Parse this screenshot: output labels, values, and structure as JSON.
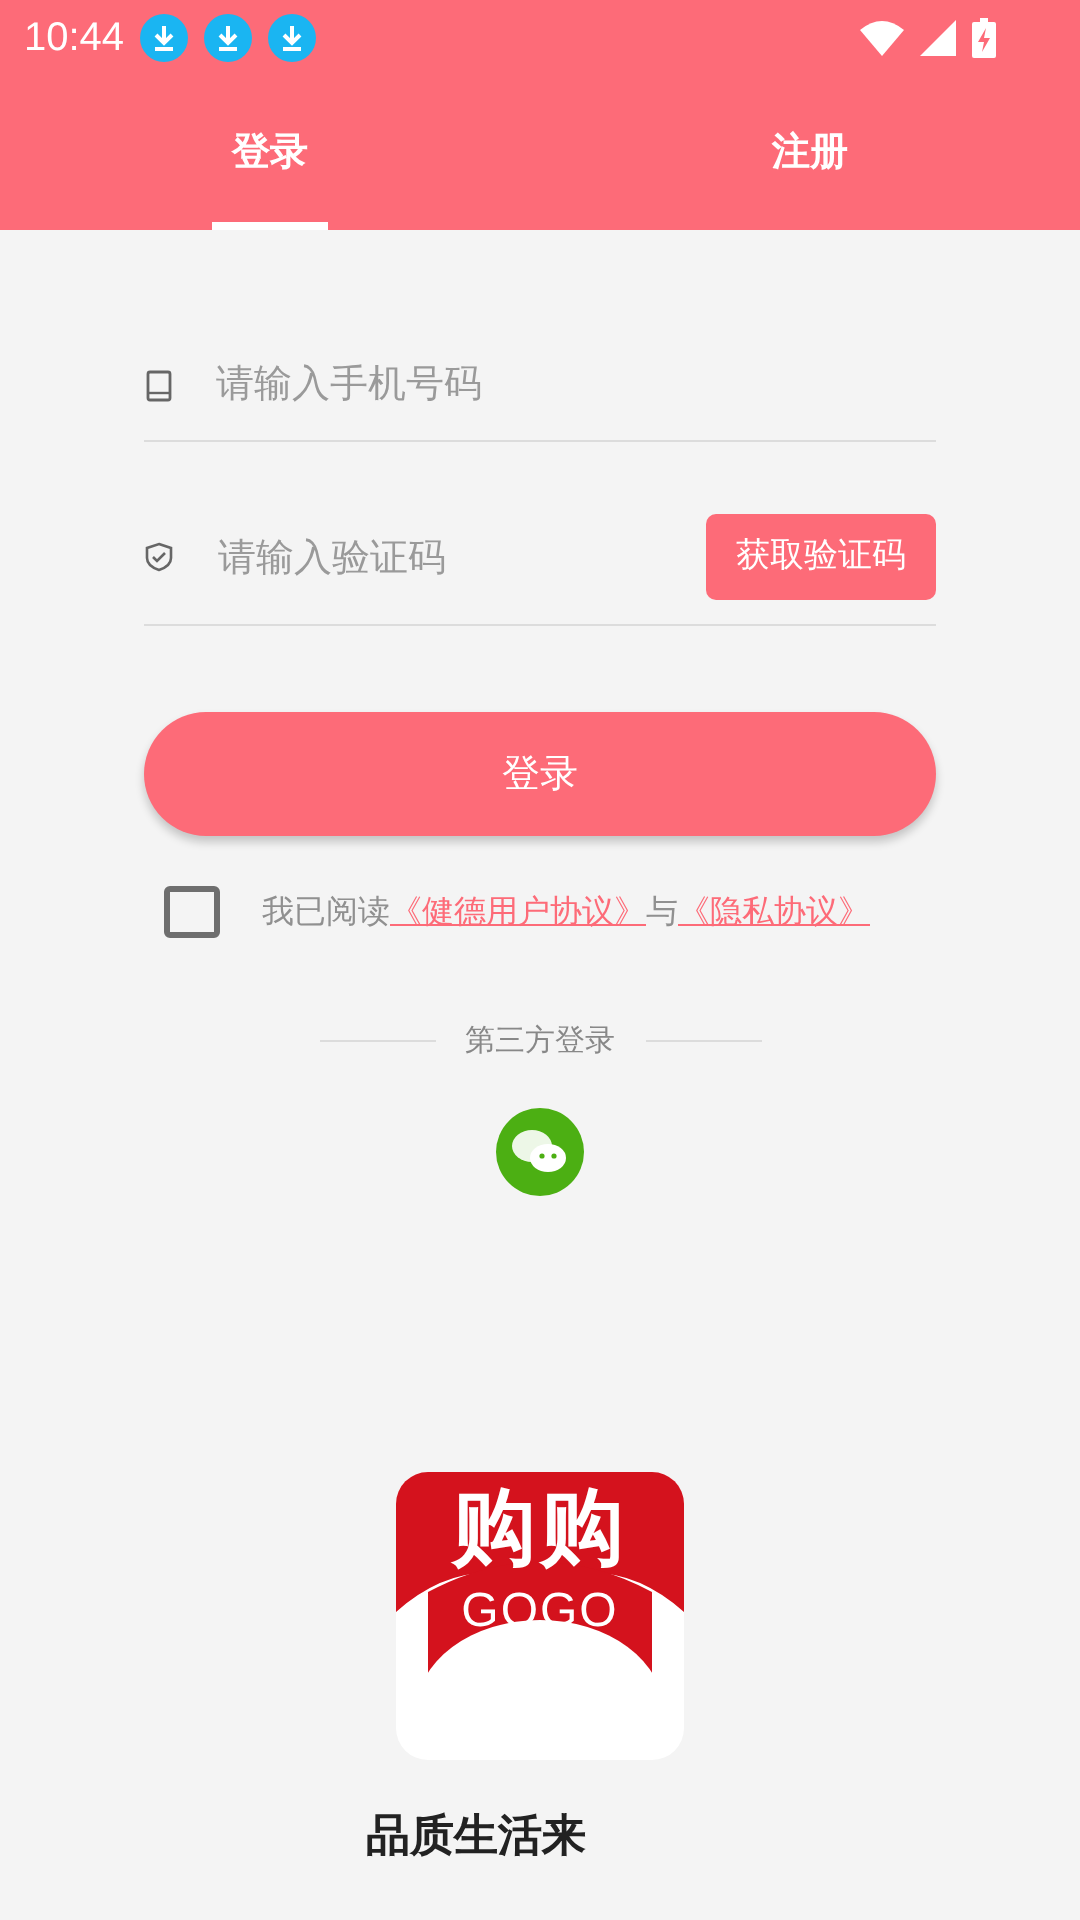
{
  "status_bar": {
    "time": "10:44",
    "notifications": [
      {
        "kind": "download"
      },
      {
        "kind": "download"
      },
      {
        "kind": "download"
      }
    ]
  },
  "tabs": [
    {
      "label": "登录",
      "selected": true
    },
    {
      "label": "注册",
      "selected": false
    }
  ],
  "phone_field": {
    "placeholder": "请输入手机号码"
  },
  "code_field": {
    "placeholder": "请输入验证码",
    "button": "获取验证码"
  },
  "login_button": "登录",
  "agreement": {
    "checked": false,
    "prefix": "我已阅读",
    "link_1": "《健德用户协议》",
    "joiner": "与",
    "link_2": "《隐私协议》"
  },
  "third_party": {
    "title": "第三方登录",
    "options": [
      {
        "kind": "wechat"
      }
    ]
  },
  "logo": {
    "mark": "购购",
    "wordmark": "GOGO"
  },
  "tagline": "品质生活来"
}
